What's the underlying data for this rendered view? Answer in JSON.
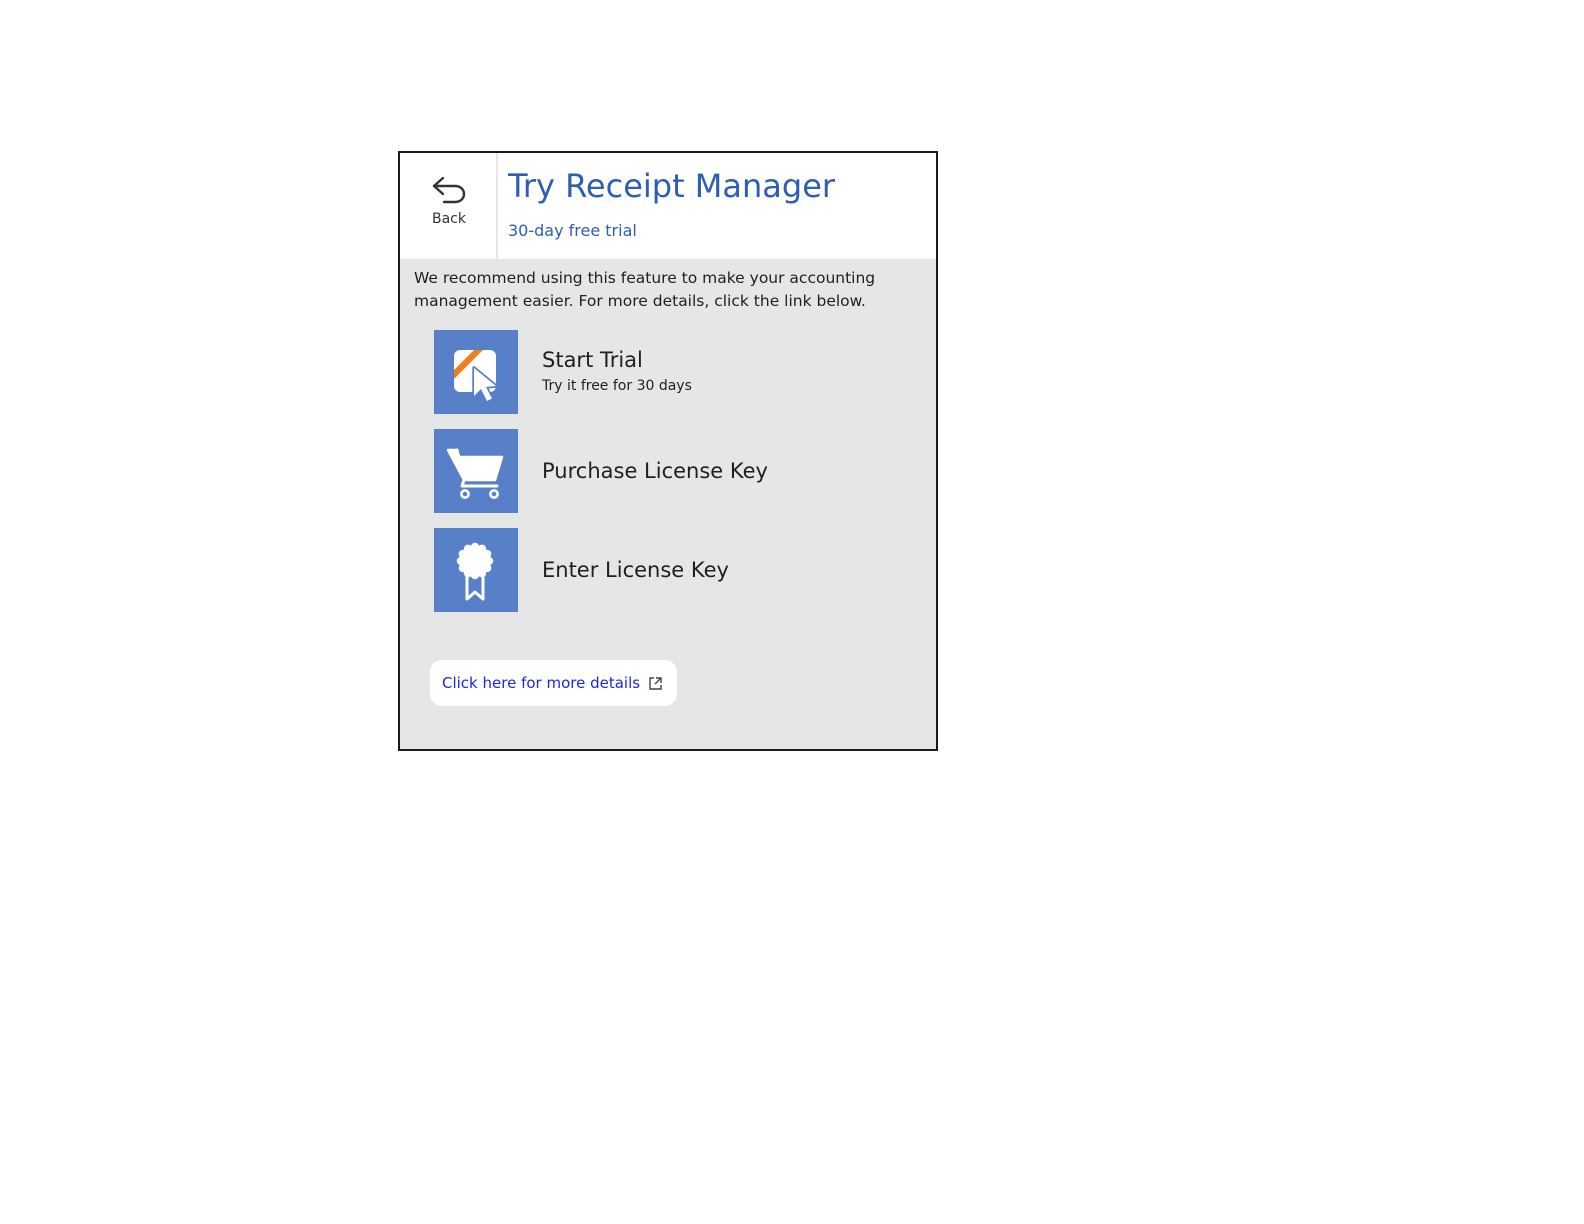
{
  "header": {
    "back_label": "Back",
    "title": "Try Receipt Manager",
    "subtitle": "30-day free trial"
  },
  "description": "We recommend using this feature to make your accounting management easier. For more details, click the link below.",
  "options": [
    {
      "title": "Start Trial",
      "subtitle": "Try it free for 30 days",
      "icon": "cursor-click-icon"
    },
    {
      "title": "Purchase License Key",
      "icon": "shopping-cart-icon"
    },
    {
      "title": "Enter License Key",
      "icon": "award-ribbon-icon"
    }
  ],
  "details_link": {
    "label": "Click here for more details",
    "icon": "external-link-icon"
  },
  "colors": {
    "accent_title": "#2e5db4",
    "tile_blue": "#5880c8",
    "orange_stripe": "#f07d1e",
    "panel_gray": "#e6e6e6",
    "link_blue": "#2323e6"
  }
}
